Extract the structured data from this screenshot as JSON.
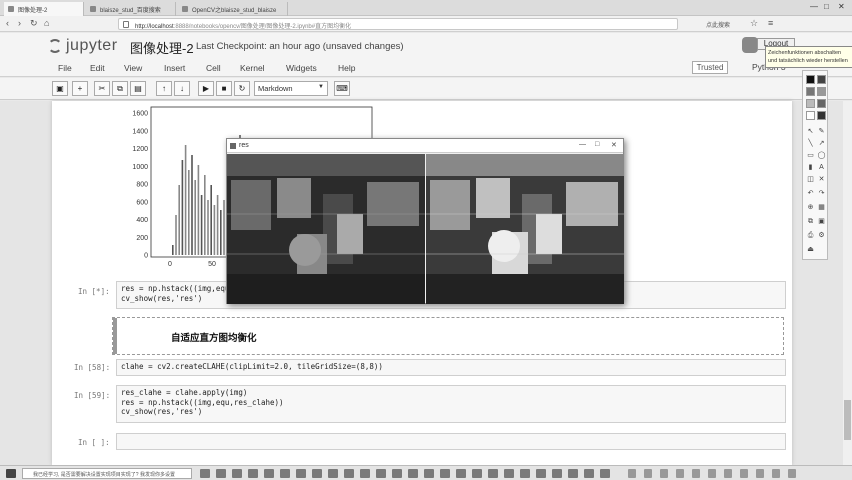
{
  "browser": {
    "tabs": [
      {
        "label": "图像处理-2"
      },
      {
        "label": "blaisze_stud_百度搜索"
      },
      {
        "label": "OpenCV之blaisze_stud_blaisze"
      }
    ],
    "url_host": "http://localhost",
    "url_path": ":8888/notebooks/opencv/图像处理/图像处理-2.ipynb#直方图均衡化",
    "right_text": "点此搜索"
  },
  "jupyter": {
    "logo_text": "jupyter",
    "notebook_title": "图像处理-2",
    "checkpoint": "Last Checkpoint: an hour ago (unsaved changes)",
    "logout": "Logout",
    "tooltip": "Zeichenfunktionen abschalten und tatsächlich wieder herstellen",
    "trusted": "Trusted",
    "kernel": "Python 3"
  },
  "menu": [
    "File",
    "Edit",
    "View",
    "Insert",
    "Cell",
    "Kernel",
    "Widgets",
    "Help"
  ],
  "toolbar": {
    "cell_type": "Markdown"
  },
  "histogram": {
    "y_ticks": [
      "1600",
      "1400",
      "1200",
      "1000",
      "800",
      "600",
      "400",
      "200",
      "0"
    ],
    "x_ticks": [
      "0",
      "50"
    ]
  },
  "image_window": {
    "title": "res"
  },
  "cells": [
    {
      "prompt": "In [*]:",
      "lines": [
        "res = np.hstack((img,equ))",
        "cv_show(res,'res')"
      ]
    },
    {
      "markdown": "自适应直方图均衡化"
    },
    {
      "prompt": "In [58]:",
      "lines": [
        "clahe = cv2.createCLAHE(clipLimit=2.0, tileGridSize=(8,8))"
      ]
    },
    {
      "prompt": "In [59]:",
      "lines": [
        "res_clahe = clahe.apply(img)",
        "res = np.hstack((img,equ,res_clahe))",
        "cv_show(res,'res')"
      ]
    },
    {
      "prompt": "In [ ]:",
      "lines": [
        ""
      ]
    }
  ],
  "taskbar": {
    "search_placeholder": "我已经学习, 是否需要解决设置实现项目实现了? 我发现你多设置",
    "time": "",
    "date": ""
  }
}
